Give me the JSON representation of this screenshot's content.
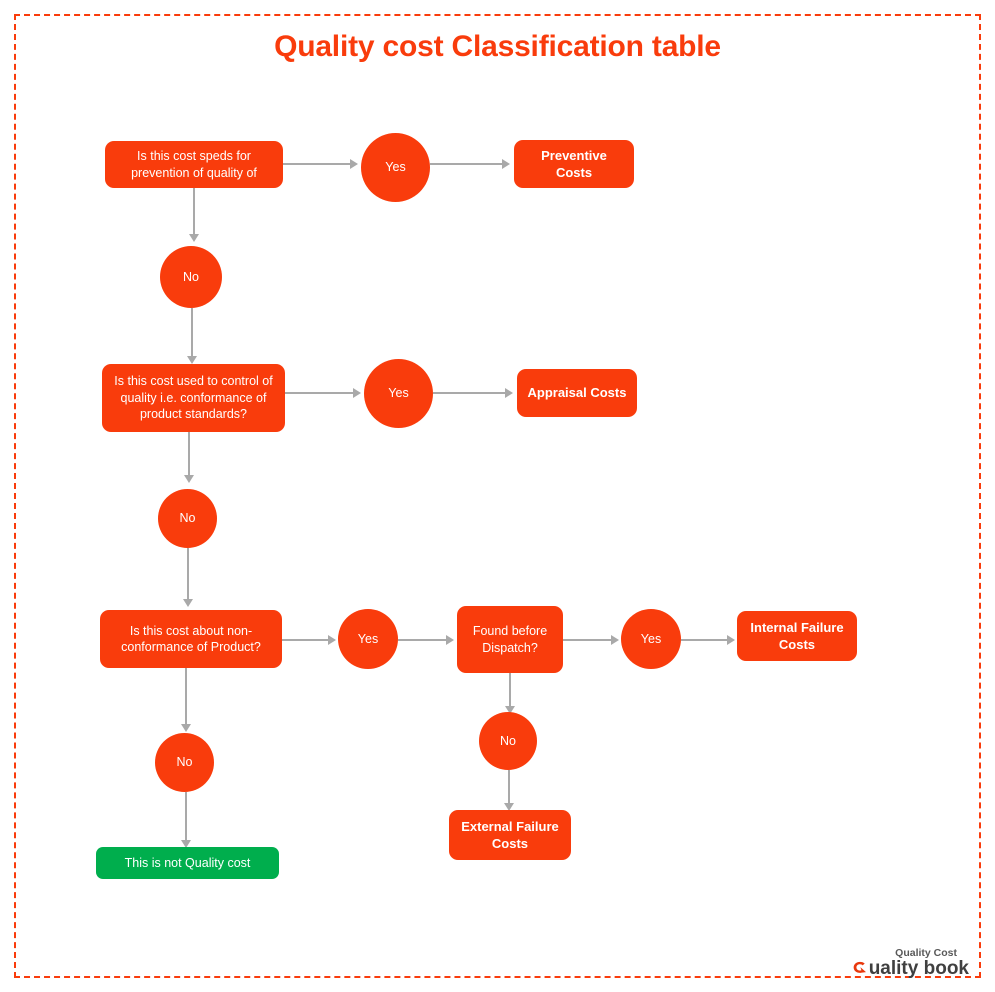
{
  "page": {
    "title": "Quality cost Classification table",
    "background_color": "#ffffff",
    "border_color": "#f93c0c",
    "accent_color": "#f93c0c",
    "success_color": "#00ae4d",
    "connector_color": "#a9a9a9"
  },
  "flow": {
    "decisions": [
      {
        "id": "d1",
        "label": "Is this cost speds for\nprevention of quality of"
      },
      {
        "id": "d2",
        "label": "Is this cost used to control of\nquality i.e. conformance of\nproduct standards?"
      },
      {
        "id": "d3",
        "label": "Is this cost about non-\nconformance of Product?"
      },
      {
        "id": "d4",
        "label": "Found before\nDispatch?"
      }
    ],
    "branches": [
      {
        "id": "y1",
        "label": "Yes"
      },
      {
        "id": "n1",
        "label": "No"
      },
      {
        "id": "y2",
        "label": "Yes"
      },
      {
        "id": "n2",
        "label": "No"
      },
      {
        "id": "y3",
        "label": "Yes"
      },
      {
        "id": "n3",
        "label": "No"
      },
      {
        "id": "y4",
        "label": "Yes"
      },
      {
        "id": "n4",
        "label": "No"
      }
    ],
    "outcomes": [
      {
        "id": "o1",
        "label": "Preventive Costs",
        "color": "#f93c0c"
      },
      {
        "id": "o2",
        "label": "Appraisal  Costs",
        "color": "#f93c0c"
      },
      {
        "id": "o3",
        "label": "Internal Failure\nCosts",
        "color": "#f93c0c"
      },
      {
        "id": "o4",
        "label": "External Failure\nCosts",
        "color": "#f93c0c"
      },
      {
        "id": "o5",
        "label": "This is not Quality cost",
        "color": "#00ae4d"
      }
    ]
  },
  "logo": {
    "tagline": "Quality Cost",
    "wordmark": "uality book"
  }
}
